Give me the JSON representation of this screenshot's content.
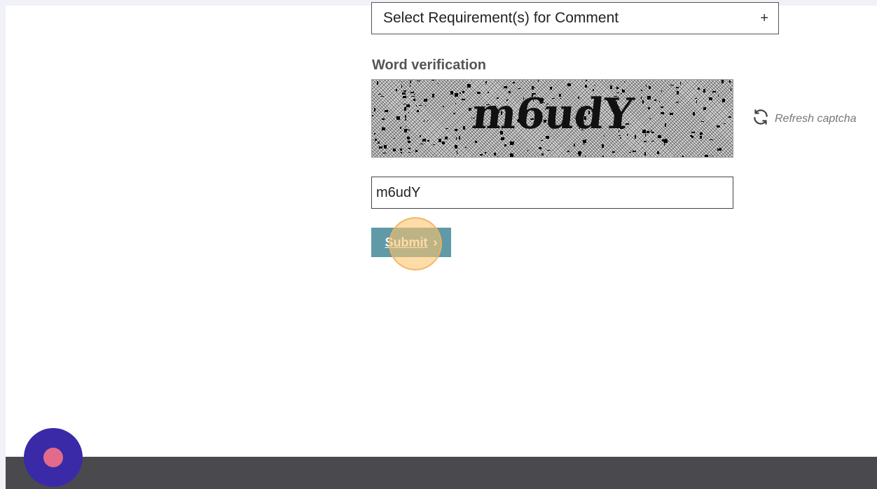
{
  "form": {
    "requirement_select": {
      "label": "Select Requirement(s) for Comment",
      "toggle": "+"
    },
    "word_verification": {
      "label": "Word verification",
      "captcha_text": "m6udY",
      "refresh_label": "Refresh captcha"
    },
    "captcha_input": {
      "value": "m6udY"
    },
    "submit": {
      "label": "Submit",
      "arrow": "›"
    }
  },
  "icons": {
    "refresh": "refresh-icon",
    "submit_arrow": "chevron-right-icon",
    "chat": "chat-widget-icon"
  },
  "colors": {
    "submit_bg": "#5f9aa6",
    "footer_bg": "#4a4a4e",
    "chat_widget_bg": "#3a2aa8",
    "chat_widget_dot": "#e36a8a",
    "click_marker": "#fdc46e"
  }
}
